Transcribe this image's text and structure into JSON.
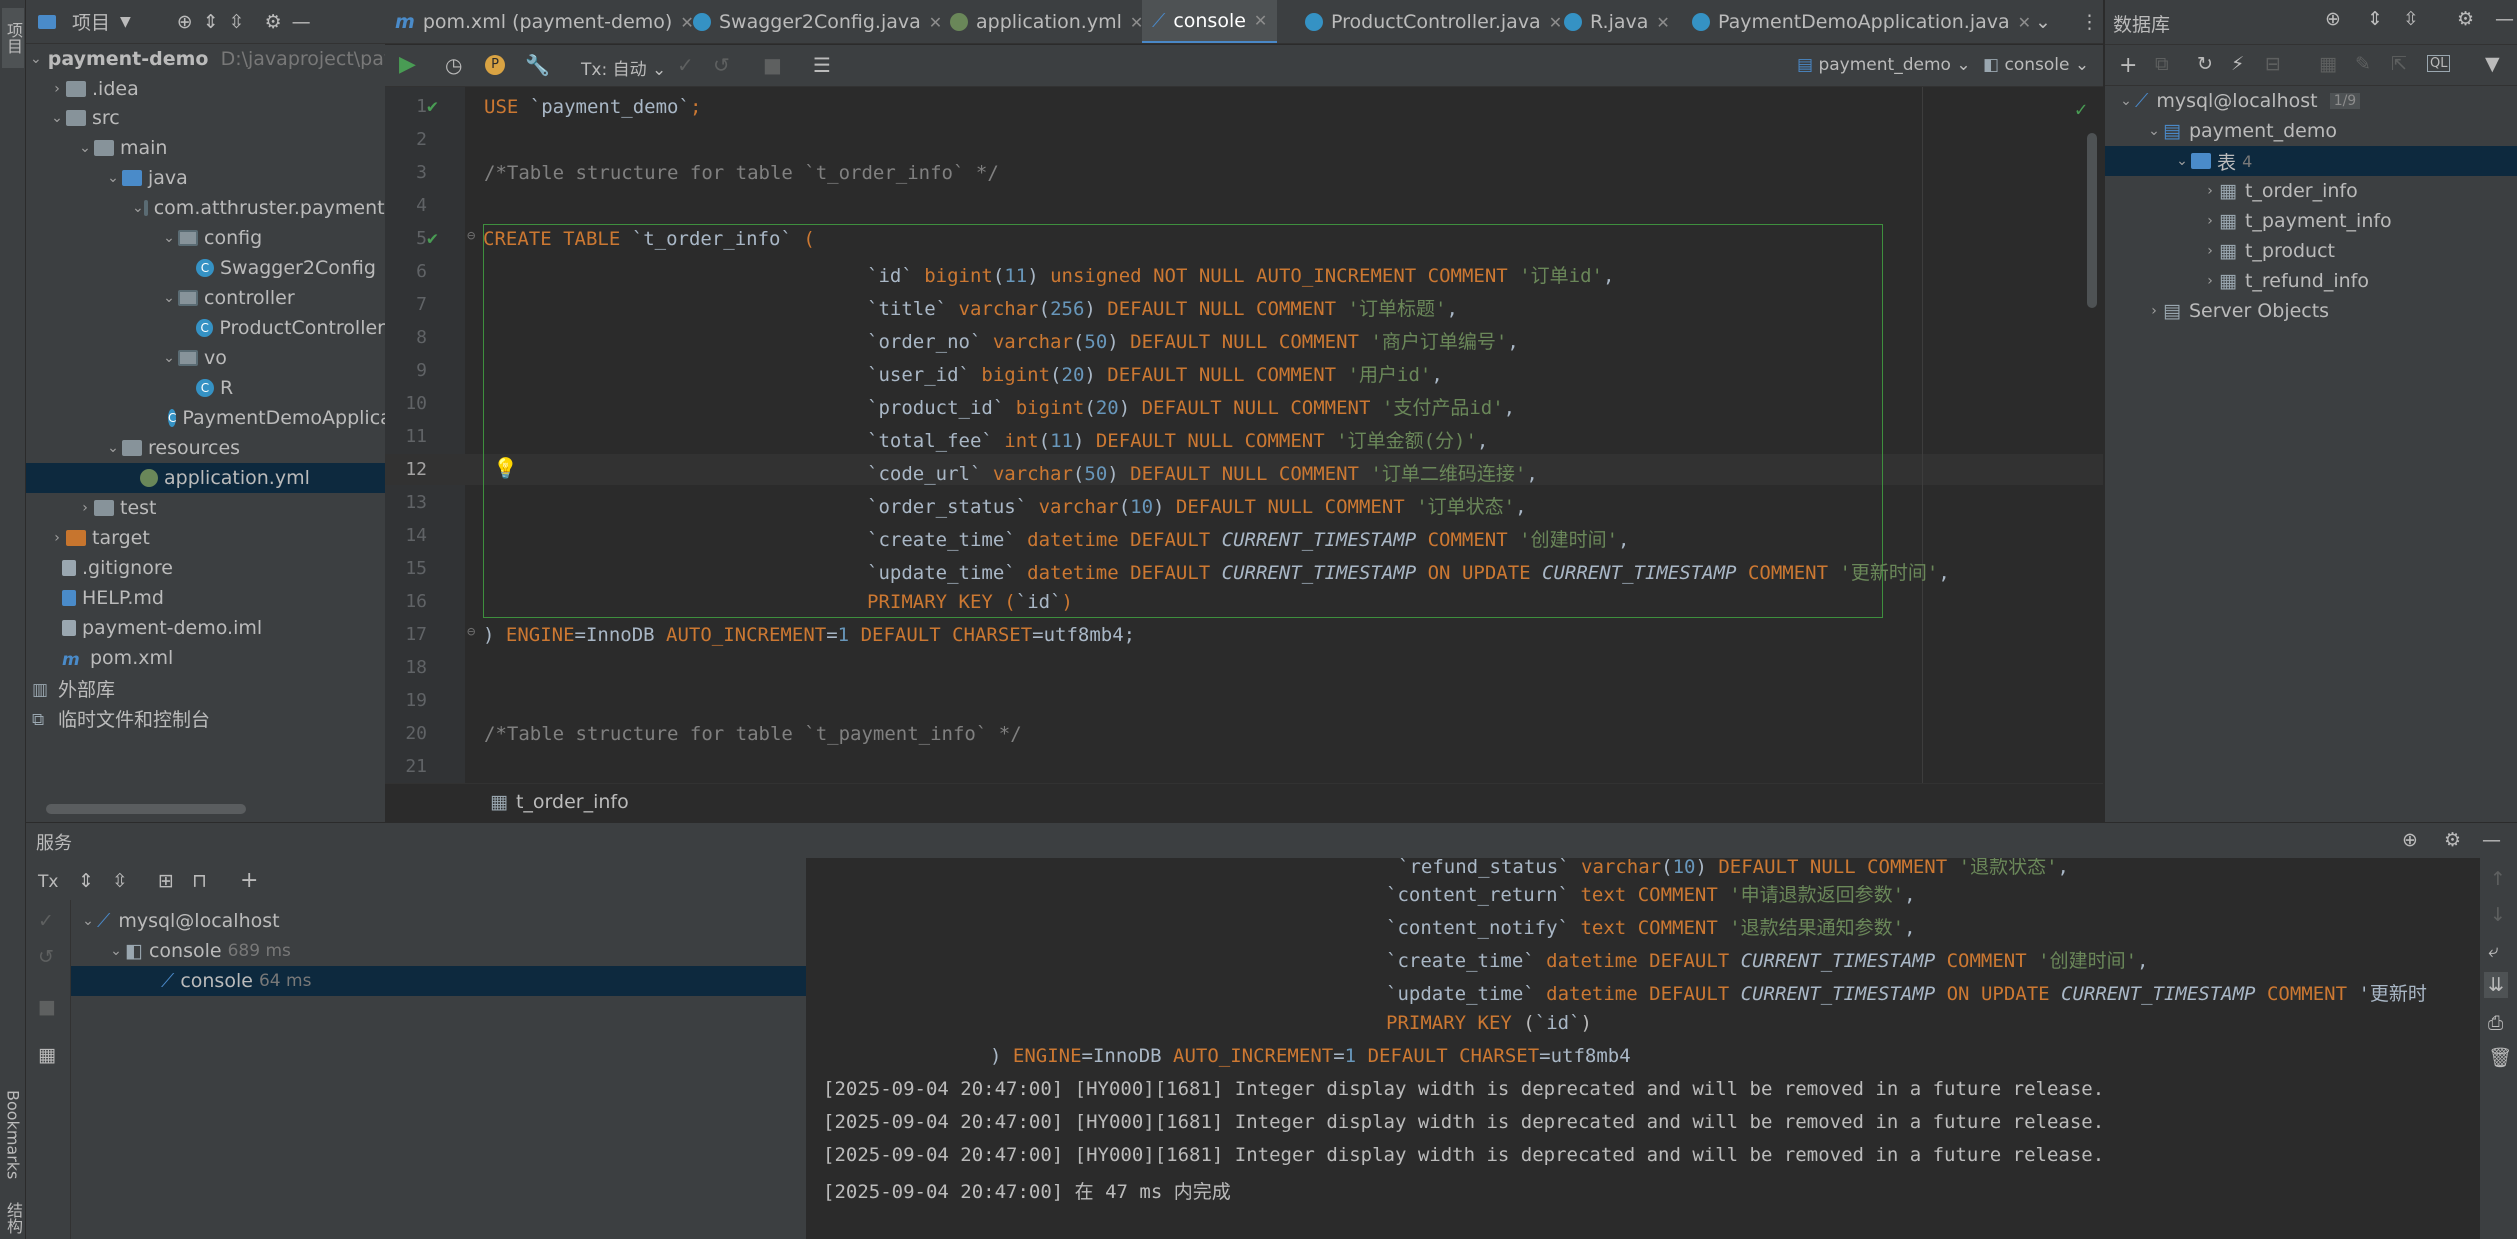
{
  "left_strip": {
    "project_label": "项目",
    "bookmarks_label": "Bookmarks",
    "structure_label": "结构"
  },
  "project": {
    "header": "项目",
    "items": [
      {
        "label": "payment-demo",
        "note": "D:\\javaproject\\payment-demo"
      },
      {
        "label": ".idea"
      },
      {
        "label": "src"
      },
      {
        "label": "main"
      },
      {
        "label": "java"
      },
      {
        "label": "com.atthruster.paymentdemo"
      },
      {
        "label": "config"
      },
      {
        "label": "Swagger2Config"
      },
      {
        "label": "controller"
      },
      {
        "label": "ProductController"
      },
      {
        "label": "vo"
      },
      {
        "label": "R"
      },
      {
        "label": "PaymentDemoApplication"
      },
      {
        "label": "resources"
      },
      {
        "label": "application.yml"
      },
      {
        "label": "test"
      },
      {
        "label": "target"
      },
      {
        "label": ".gitignore"
      },
      {
        "label": "HELP.md"
      },
      {
        "label": "payment-demo.iml"
      },
      {
        "label": "pom.xml"
      },
      {
        "label": "外部库"
      },
      {
        "label": "临时文件和控制台"
      }
    ]
  },
  "tabs": [
    {
      "label": "pom.xml (payment-demo)"
    },
    {
      "label": "Swagger2Config.java"
    },
    {
      "label": "application.yml"
    },
    {
      "label": "console"
    },
    {
      "label": "ProductController.java"
    },
    {
      "label": "R.java"
    },
    {
      "label": "PaymentDemoApplication.java"
    }
  ],
  "toolbar": {
    "tx_label": "Tx: 自动",
    "schema": "payment_demo",
    "session": "console"
  },
  "editor": {
    "line_numbers": [
      "1",
      "2",
      "3",
      "4",
      "5",
      "6",
      "7",
      "8",
      "9",
      "10",
      "11",
      "12",
      "13",
      "14",
      "15",
      "16",
      "17",
      "18",
      "19",
      "20",
      "21"
    ],
    "lines": [
      "USE `payment_demo`;",
      "",
      "/*Table structure for table `t_order_info` */",
      "",
      "CREATE TABLE `t_order_info` (",
      "`id` bigint(11) unsigned NOT NULL AUTO_INCREMENT COMMENT '订单id',",
      "`title` varchar(256) DEFAULT NULL COMMENT '订单标题',",
      "`order_no` varchar(50) DEFAULT NULL COMMENT '商户订单编号',",
      "`user_id` bigint(20) DEFAULT NULL COMMENT '用户id',",
      "`product_id` bigint(20) DEFAULT NULL COMMENT '支付产品id',",
      "`total_fee` int(11) DEFAULT NULL COMMENT '订单金额(分)',",
      "`code_url` varchar(50) DEFAULT NULL COMMENT '订单二维码连接',",
      "`order_status` varchar(10) DEFAULT NULL COMMENT '订单状态',",
      "`create_time` datetime DEFAULT CURRENT_TIMESTAMP COMMENT '创建时间',",
      "`update_time` datetime DEFAULT CURRENT_TIMESTAMP ON UPDATE CURRENT_TIMESTAMP COMMENT '更新时间',",
      "PRIMARY KEY (`id`)",
      ") ENGINE=InnoDB AUTO_INCREMENT=1 DEFAULT CHARSET=utf8mb4;",
      "",
      "",
      "/*Table structure for table `t_payment_info` */",
      ""
    ],
    "breadcrumb": "t_order_info"
  },
  "db": {
    "title": "数据库",
    "conn": "mysql@localhost",
    "conn_badge": "1/9",
    "schema": "payment_demo",
    "tables_label": "表",
    "tables_count": "4",
    "tables": [
      "t_order_info",
      "t_payment_info",
      "t_product",
      "t_refund_info"
    ],
    "server_objects": "Server Objects"
  },
  "services": {
    "title": "服务",
    "tx": "Tx",
    "conn": "mysql@localhost",
    "console_parent": "console",
    "console_parent_time": "689 ms",
    "console_child": "console",
    "console_child_time": "64 ms"
  },
  "console": {
    "lines": [
      "`refund_status` varchar(10) DEFAULT NULL COMMENT '退款状态',",
      "`content_return` text COMMENT '申请退款返回参数',",
      "`content_notify` text COMMENT '退款结果通知参数',",
      "`create_time` datetime DEFAULT CURRENT_TIMESTAMP COMMENT '创建时间',",
      "`update_time` datetime DEFAULT CURRENT_TIMESTAMP ON UPDATE CURRENT_TIMESTAMP COMMENT '更新时",
      "PRIMARY KEY (`id`)",
      ") ENGINE=InnoDB AUTO_INCREMENT=1 DEFAULT CHARSET=utf8mb4",
      "[2025-09-04 20:47:00] [HY000][1681] Integer display width is deprecated and will be removed in a future release.",
      "[2025-09-04 20:47:00] [HY000][1681] Integer display width is deprecated and will be removed in a future release.",
      "[2025-09-04 20:47:00] [HY000][1681] Integer display width is deprecated and will be removed in a future release.",
      "[2025-09-04 20:47:00] 在 47 ms 内完成"
    ]
  }
}
